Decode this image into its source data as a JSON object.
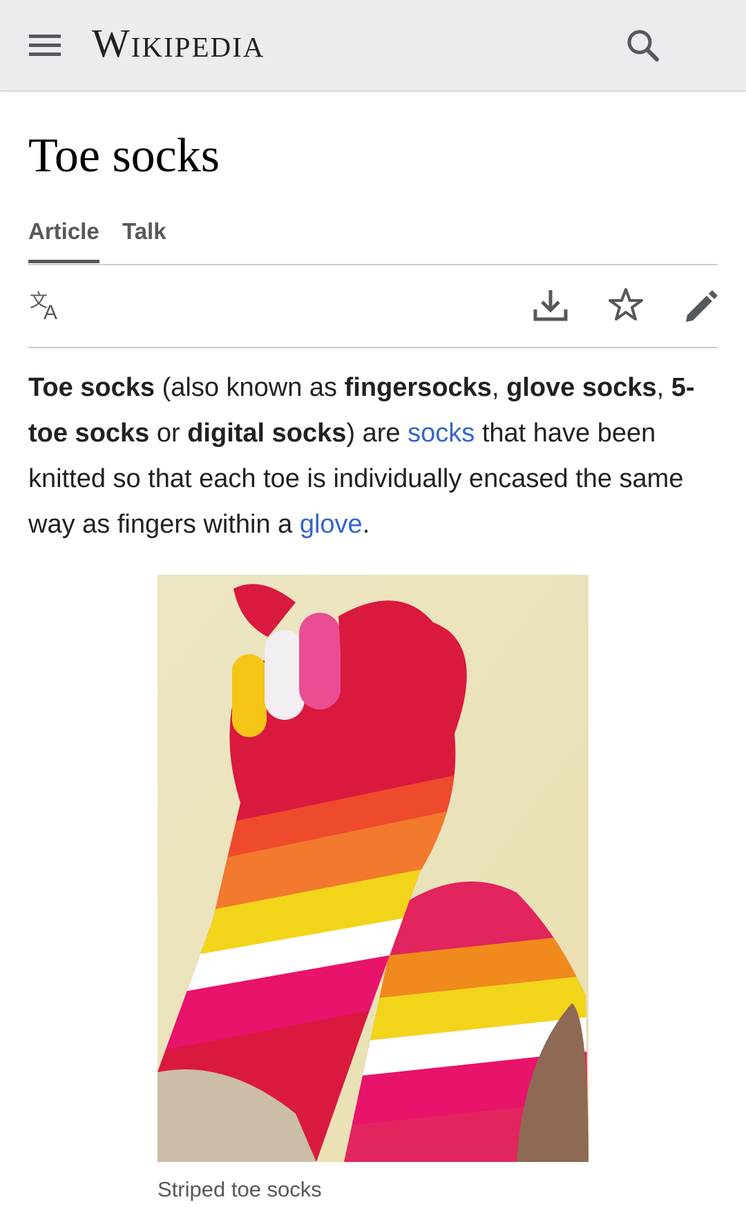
{
  "header": {
    "wordmark": "Wikipedia",
    "menu_icon": "hamburger-menu-icon",
    "search_icon": "search-icon"
  },
  "article": {
    "title": "Toe socks",
    "tabs": [
      {
        "label": "Article",
        "selected": true
      },
      {
        "label": "Talk",
        "selected": false
      }
    ],
    "toolbar": {
      "language_icon": "language-icon",
      "download_icon": "download-icon",
      "watch_icon": "star-icon",
      "edit_icon": "pencil-edit-icon"
    },
    "lead": {
      "t1": "Toe socks",
      "t2": " (also known as ",
      "t3": "fingersocks",
      "t4": ", ",
      "t5": "glove socks",
      "t6": ", ",
      "t7": "5-toe socks",
      "t8": " or ",
      "t9": "digital socks",
      "t10": ") are ",
      "link1": "socks",
      "t11": " that have been knitted so that each toe is individually encased the same way as fingers within a ",
      "link2": "glove",
      "t12": "."
    },
    "figure": {
      "caption": "Striped toe socks"
    }
  },
  "colors": {
    "header_bg": "#eaecf0",
    "link": "#3366cc",
    "text": "#202122",
    "muted": "#54595d",
    "divider": "#c8ccd1"
  }
}
